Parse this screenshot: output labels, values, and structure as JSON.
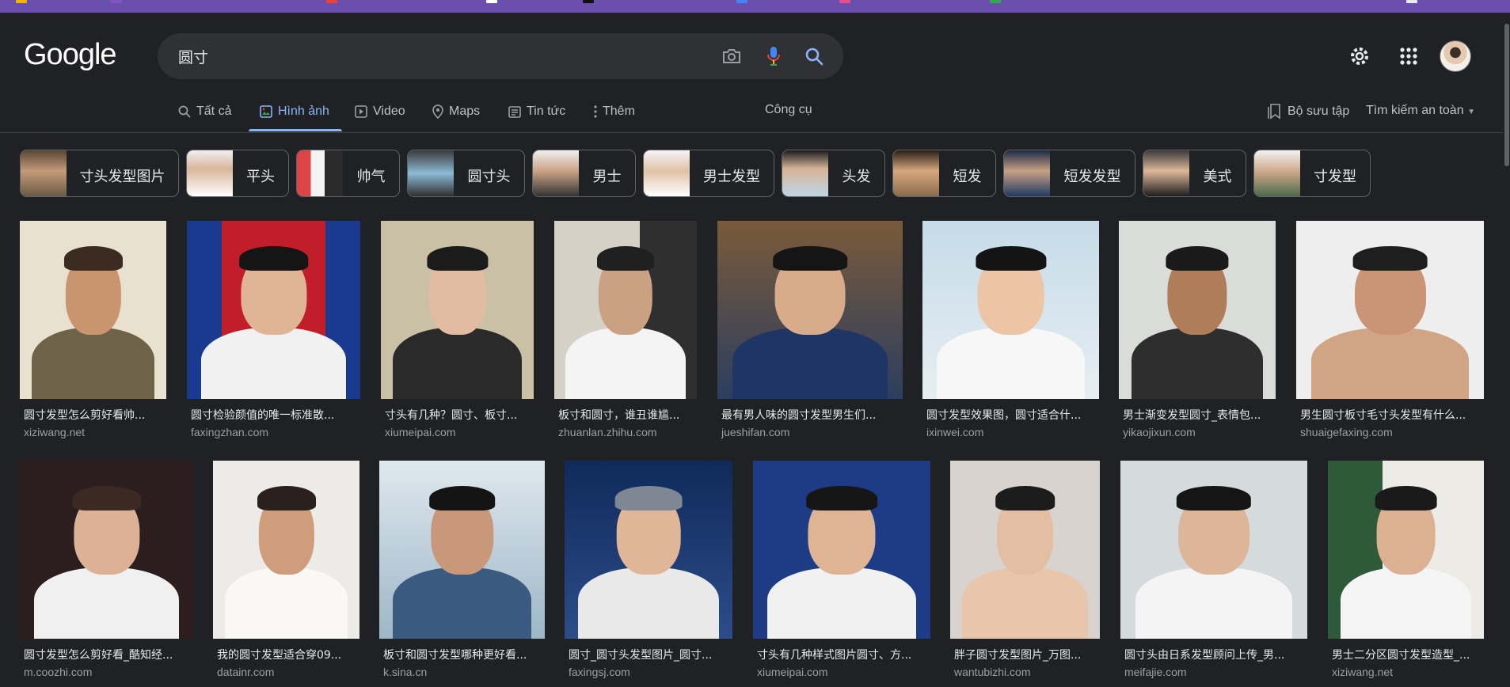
{
  "logo": "Google",
  "search": {
    "query": "圆寸",
    "camera_icon": "camera-icon",
    "mic_icon": "microphone-icon",
    "search_icon": "search-icon"
  },
  "header": {
    "settings_icon": "gear-icon",
    "apps_icon": "apps-grid-icon",
    "avatar": "avatar"
  },
  "tabs": [
    {
      "label": "Tất cả",
      "icon": "search-icon",
      "active": false
    },
    {
      "label": "Hình ảnh",
      "icon": "image-icon",
      "active": true
    },
    {
      "label": "Video",
      "icon": "video-icon",
      "active": false
    },
    {
      "label": "Maps",
      "icon": "map-pin-icon",
      "active": false
    },
    {
      "label": "Tin tức",
      "icon": "news-icon",
      "active": false
    },
    {
      "label": "Thêm",
      "icon": "more-vert-icon",
      "active": false
    }
  ],
  "tools_label": "Công cụ",
  "collection_label": "Bộ sưu tập",
  "safesearch_label": "Tìm kiếm an toàn",
  "chips": [
    {
      "label": "寸头发型图片"
    },
    {
      "label": "平头"
    },
    {
      "label": "帅气"
    },
    {
      "label": "圆寸头"
    },
    {
      "label": "男士"
    },
    {
      "label": "男士发型"
    },
    {
      "label": "头发"
    },
    {
      "label": "短发"
    },
    {
      "label": "短发发型"
    },
    {
      "label": "美式"
    },
    {
      "label": "寸发型"
    }
  ],
  "results_row1": [
    {
      "title": "圆寸发型怎么剪好看帅...",
      "source": "xiziwang.net"
    },
    {
      "title": "圆寸检验颜值的唯一标准散...",
      "source": "faxingzhan.com"
    },
    {
      "title": "寸头有几种？圆寸、板寸...",
      "source": "xiumeipai.com"
    },
    {
      "title": "板寸和圆寸，谁丑谁尴...",
      "source": "zhuanlan.zhihu.com"
    },
    {
      "title": "最有男人味的圆寸发型男生们...",
      "source": "jueshifan.com"
    },
    {
      "title": "圆寸发型效果图，圆寸适合什...",
      "source": "ixinwei.com"
    },
    {
      "title": "男士渐变发型圆寸_表情包...",
      "source": "yikaojixun.com"
    },
    {
      "title": "男生圆寸板寸毛寸头发型有什么...",
      "source": "shuaigefaxing.com"
    }
  ],
  "results_row2": [
    {
      "title": "圆寸发型怎么剪好看_酷知经...",
      "source": "m.coozhi.com"
    },
    {
      "title": "我的圆寸发型适合穿09...",
      "source": "datainr.com"
    },
    {
      "title": "板寸和圆寸发型哪种更好看...",
      "source": "k.sina.cn"
    },
    {
      "title": "圆寸_圆寸头发型图片_圆寸...",
      "source": "faxingsj.com"
    },
    {
      "title": "寸头有几种样式图片圆寸、方...",
      "source": "xiumeipai.com"
    },
    {
      "title": "胖子圆寸发型图片_万图...",
      "source": "wantubizhi.com"
    },
    {
      "title": "圆寸头由日系发型顾问上传_男...",
      "source": "meifajie.com"
    },
    {
      "title": "男士二分区圆寸发型造型_...",
      "source": "xiziwang.net"
    }
  ],
  "colors": {
    "background": "#202124",
    "accent": "#8ab4f8",
    "text": "#e8eaed",
    "muted": "#9aa0a6",
    "bookmark_bar": "#6a4fae"
  }
}
